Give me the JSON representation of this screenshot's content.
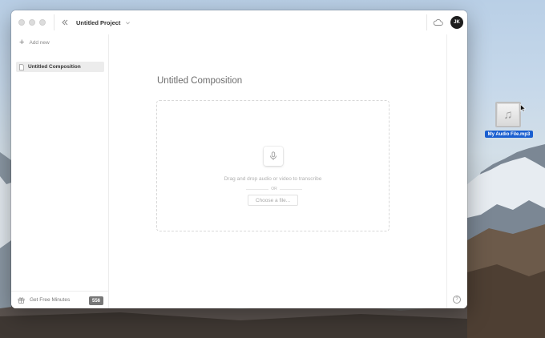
{
  "window": {
    "project_title": "Untitled Project",
    "avatar_initials": "JK"
  },
  "sidebar": {
    "add_new_label": "Add new",
    "items": [
      {
        "label": "Untitled Composition"
      }
    ],
    "footer": {
      "free_minutes_label": "Get Free Minutes",
      "minutes_badge": "556"
    }
  },
  "main": {
    "composition_title": "Untitled Composition",
    "drop_text": "Drag and drop audio or video to transcribe",
    "or_label": "OR",
    "choose_button_label": "Choose a file..."
  },
  "right_rail": {
    "help_label": "?"
  },
  "desktop": {
    "file_label": "My Audio File.mp3",
    "file_glyph": "♫"
  },
  "icons": {
    "collapse": "chevrons-left-icon",
    "chevron": "chevron-down-icon",
    "cloud": "cloud-icon",
    "document": "document-icon",
    "gift": "gift-icon",
    "microphone": "microphone-icon",
    "help": "help-circle-icon"
  },
  "colors": {
    "selection_blue": "#1a5fd0",
    "avatar_bg": "#1e1e1e",
    "badge_bg": "#777777"
  }
}
